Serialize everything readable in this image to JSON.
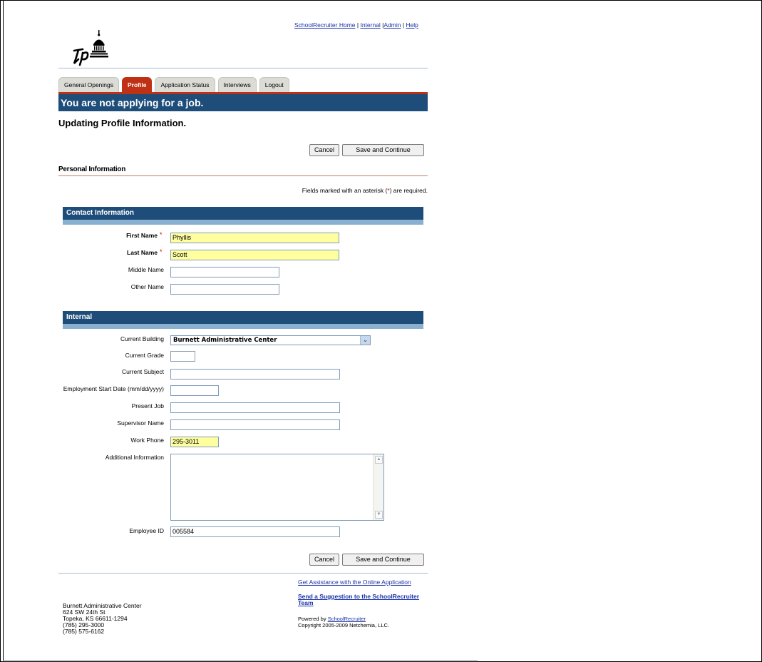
{
  "header": {
    "links": [
      "SchoolRecruiter Home",
      "Internal",
      "Admin",
      "Help"
    ],
    "sep": " | "
  },
  "tabs": [
    "General Openings",
    "Profile",
    "Application Status",
    "Interviews",
    "Logout"
  ],
  "active_tab": "Profile",
  "banner": "You are not applying for a job.",
  "heading": "Updating Profile Information.",
  "buttons": {
    "cancel": "Cancel",
    "save": "Save and Continue"
  },
  "personal_heading": "Personal Information",
  "required_note": {
    "before": "Fields marked with an asterisk (",
    "star": "*",
    "after": ") are required."
  },
  "contact": {
    "title": "Contact Information",
    "first_name": {
      "label": "First Name",
      "value": "Phyllis"
    },
    "last_name": {
      "label": "Last Name",
      "value": "Scott"
    },
    "middle_name": {
      "label": "Middle Name",
      "value": ""
    },
    "other_name": {
      "label": "Other Name",
      "value": ""
    }
  },
  "internal": {
    "title": "Internal",
    "current_building": {
      "label": "Current Building",
      "value": "Burnett Administrative Center"
    },
    "current_grade": {
      "label": "Current Grade",
      "value": ""
    },
    "current_subject": {
      "label": "Current Subject",
      "value": ""
    },
    "employment_start": {
      "label": "Employment Start Date (mm/dd/yyyy)",
      "value": ""
    },
    "present_job": {
      "label": "Present Job",
      "value": ""
    },
    "supervisor_name": {
      "label": "Supervisor Name",
      "value": ""
    },
    "work_phone": {
      "label": "Work Phone",
      "value": "295-3011"
    },
    "additional_info": {
      "label": "Additional Information",
      "value": ""
    },
    "employee_id": {
      "label": "Employee ID",
      "value": "005584"
    }
  },
  "footer": {
    "assist": "Get Assistance with the Online Application",
    "suggestion": "Send a Suggestion to the SchoolRecruiter Team",
    "address": [
      "Burnett Administrative Center",
      "624 SW 24th St",
      "Topeka, KS 66611-1294",
      "(785) 295-3000",
      "(785) 575-6162"
    ],
    "powered_by": "Powered by",
    "powered_link": "SchoolRecruiter",
    "copyright": "Copyright 2005-2009 Netchemia, LLC."
  },
  "colors": {
    "accent_blue": "#1e4d7a",
    "tab_red": "#c03015",
    "required_yellow": "#ffffa0"
  }
}
